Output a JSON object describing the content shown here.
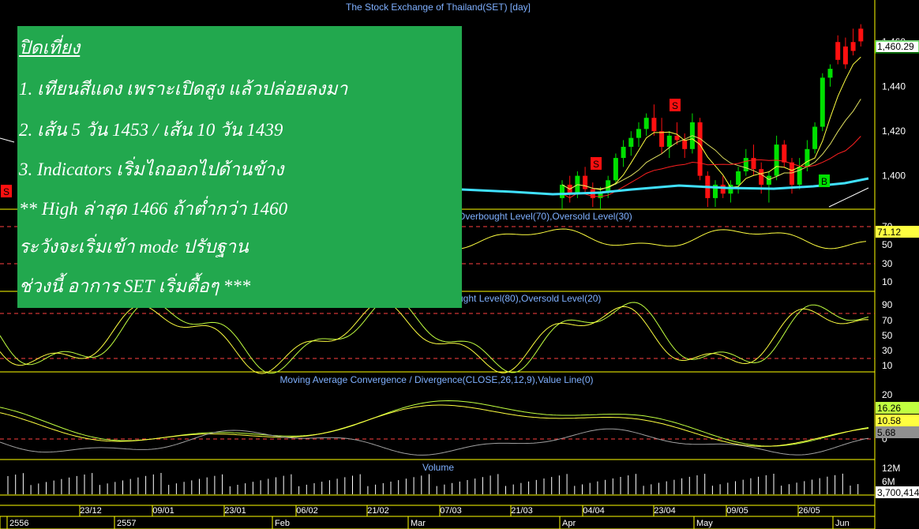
{
  "chart_title": "The Stock Exchange of Thailand(SET) [day]",
  "panels": {
    "rsi_title": "Overbought Level(70),Oversold Level(30)",
    "stoch_title": "ught Level(80),Oversold Level(20)",
    "macd_title": "Moving Average Convergence / Divergence(CLOSE,26,12,9),Value Line(0)",
    "volume_title": "Volume"
  },
  "axes": {
    "price_ticks": [
      "1,460",
      "1,440",
      "1,420",
      "1,400"
    ],
    "rsi_ticks": [
      "70",
      "50",
      "30",
      "10"
    ],
    "stoch_ticks": [
      "90",
      "70",
      "50",
      "30",
      "10"
    ],
    "macd_ticks": [
      "20",
      "0"
    ],
    "volume_ticks": [
      "12M",
      "6M"
    ],
    "date_ticks": [
      "23/12",
      "09/01",
      "23/01",
      "06/02",
      "21/02",
      "07/03",
      "21/03",
      "04/04",
      "23/04",
      "09/05",
      "26/05"
    ],
    "year_ticks": [
      "2556",
      "2557",
      "Feb",
      "Mar",
      "Apr",
      "May",
      "Jun"
    ]
  },
  "value_tags": {
    "price": "1,460.29",
    "rsi": "71.12",
    "macd_main": "16.26",
    "macd_signal": "10.58",
    "macd_hist": "5.68",
    "volume": "3,700,414"
  },
  "signals": [
    "S",
    "S",
    "S",
    "B"
  ],
  "note": {
    "heading": "ปิดเที่ยง",
    "line1": "1. เทียนสีแดง เพราะเปิดสูง แล้วปล่อยลงมา",
    "line2": "2. เส้น 5 วัน 1453 / เส้น 10 วัน 1439",
    "line3": "3. Indicators เริ่มไถออกไปด้านข้าง",
    "line4": "** High ล่าสุด 1466 ถ้าต่ำกว่า 1460",
    "line5": "ระวังจะเริ่มเข้า mode ปรับฐาน",
    "line6": "ช่วงนี้ อาการ SET เริ่มตื้อๆ ***"
  },
  "colors": {
    "up": "#00e000",
    "down": "#ff1010",
    "ma_short": "#ffff40",
    "ma_mid": "#ff2020",
    "ma_long": "#ffffff",
    "ma_cyan": "#40e0ff",
    "osc_main": "#c0ff40",
    "osc_signal": "#ffff40",
    "panel_title": "#7fb0ff",
    "note_bg": "#22a84e"
  },
  "chart_data": {
    "type": "candlestick",
    "title": "The Stock Exchange of Thailand(SET) [day]",
    "price_range": [
      1385,
      1470
    ],
    "last_close": 1460.29,
    "candles_visible_right": [
      {
        "o": 1390,
        "h": 1398,
        "l": 1385,
        "c": 1396
      },
      {
        "o": 1396,
        "h": 1400,
        "l": 1388,
        "c": 1392
      },
      {
        "o": 1392,
        "h": 1402,
        "l": 1390,
        "c": 1400
      },
      {
        "o": 1400,
        "h": 1404,
        "l": 1392,
        "c": 1394
      },
      {
        "o": 1394,
        "h": 1397,
        "l": 1386,
        "c": 1390
      },
      {
        "o": 1390,
        "h": 1395,
        "l": 1385,
        "c": 1393
      },
      {
        "o": 1393,
        "h": 1400,
        "l": 1390,
        "c": 1398
      },
      {
        "o": 1398,
        "h": 1410,
        "l": 1396,
        "c": 1408
      },
      {
        "o": 1408,
        "h": 1416,
        "l": 1404,
        "c": 1413
      },
      {
        "o": 1413,
        "h": 1420,
        "l": 1409,
        "c": 1417
      },
      {
        "o": 1417,
        "h": 1424,
        "l": 1413,
        "c": 1421
      },
      {
        "o": 1421,
        "h": 1428,
        "l": 1418,
        "c": 1426
      },
      {
        "o": 1426,
        "h": 1432,
        "l": 1418,
        "c": 1420
      },
      {
        "o": 1420,
        "h": 1426,
        "l": 1410,
        "c": 1413
      },
      {
        "o": 1413,
        "h": 1420,
        "l": 1408,
        "c": 1418
      },
      {
        "o": 1418,
        "h": 1424,
        "l": 1414,
        "c": 1416
      },
      {
        "o": 1416,
        "h": 1419,
        "l": 1408,
        "c": 1412
      },
      {
        "o": 1412,
        "h": 1428,
        "l": 1410,
        "c": 1424
      },
      {
        "o": 1424,
        "h": 1426,
        "l": 1398,
        "c": 1400
      },
      {
        "o": 1400,
        "h": 1402,
        "l": 1386,
        "c": 1390
      },
      {
        "o": 1390,
        "h": 1398,
        "l": 1386,
        "c": 1396
      },
      {
        "o": 1396,
        "h": 1400,
        "l": 1390,
        "c": 1392
      },
      {
        "o": 1392,
        "h": 1398,
        "l": 1388,
        "c": 1396
      },
      {
        "o": 1396,
        "h": 1404,
        "l": 1392,
        "c": 1402
      },
      {
        "o": 1402,
        "h": 1412,
        "l": 1400,
        "c": 1408
      },
      {
        "o": 1408,
        "h": 1414,
        "l": 1400,
        "c": 1403
      },
      {
        "o": 1403,
        "h": 1406,
        "l": 1392,
        "c": 1396
      },
      {
        "o": 1396,
        "h": 1402,
        "l": 1388,
        "c": 1400
      },
      {
        "o": 1400,
        "h": 1418,
        "l": 1398,
        "c": 1414
      },
      {
        "o": 1414,
        "h": 1416,
        "l": 1404,
        "c": 1406
      },
      {
        "o": 1406,
        "h": 1408,
        "l": 1392,
        "c": 1396
      },
      {
        "o": 1396,
        "h": 1408,
        "l": 1394,
        "c": 1404
      },
      {
        "o": 1404,
        "h": 1416,
        "l": 1402,
        "c": 1412
      },
      {
        "o": 1412,
        "h": 1424,
        "l": 1410,
        "c": 1422
      },
      {
        "o": 1422,
        "h": 1446,
        "l": 1420,
        "c": 1444
      },
      {
        "o": 1444,
        "h": 1450,
        "l": 1440,
        "c": 1448
      },
      {
        "o": 1460,
        "h": 1463,
        "l": 1450,
        "c": 1452
      },
      {
        "o": 1458,
        "h": 1462,
        "l": 1448,
        "c": 1450
      },
      {
        "o": 1460,
        "h": 1466,
        "l": 1454,
        "c": 1456
      },
      {
        "o": 1466,
        "h": 1468,
        "l": 1458,
        "c": 1460.29
      }
    ]
  }
}
